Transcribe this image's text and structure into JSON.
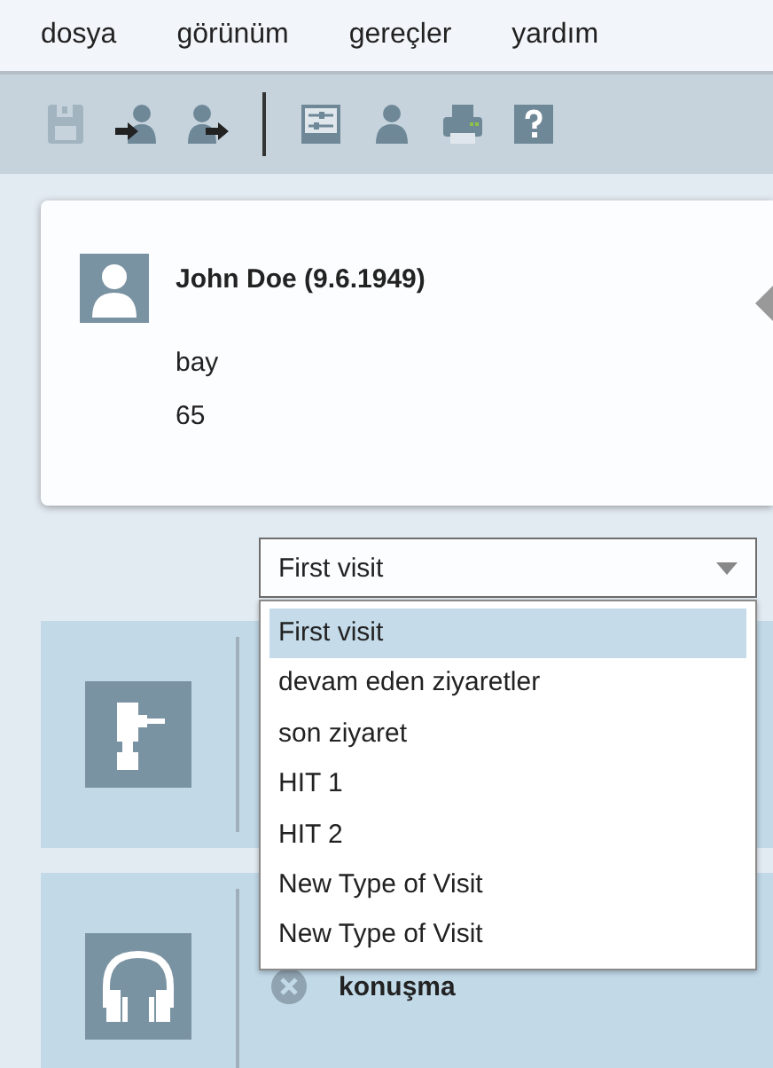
{
  "menu": [
    "dosya",
    "görünüm",
    "gereçler",
    "yardım"
  ],
  "toolbar": [
    {
      "kind": "save",
      "disabled": true
    },
    {
      "kind": "person-in",
      "disabled": false
    },
    {
      "kind": "person-out",
      "disabled": false
    },
    {
      "kind": "separator"
    },
    {
      "kind": "settings",
      "disabled": false
    },
    {
      "kind": "person",
      "disabled": false
    },
    {
      "kind": "print",
      "disabled": false
    },
    {
      "kind": "help",
      "disabled": false
    }
  ],
  "patient": {
    "name": "John Doe (9.6.1949)",
    "gender": "bay",
    "age": "65"
  },
  "visit_type": {
    "value": "First visit",
    "expanded": true,
    "options": [
      {
        "label": "First visit",
        "selected": true
      },
      {
        "label": "devam eden ziyaretler",
        "selected": false
      },
      {
        "label": "son ziyaret",
        "selected": false
      },
      {
        "label": "HIT 1",
        "selected": false
      },
      {
        "label": "HIT 2",
        "selected": false
      },
      {
        "label": "New Type of Visit",
        "selected": false
      },
      {
        "label": "New Type of Visit",
        "selected": false
      }
    ]
  },
  "panels": [
    {
      "kind": "drill"
    },
    {
      "kind": "headphones",
      "items": [
        "konuşma"
      ]
    }
  ]
}
